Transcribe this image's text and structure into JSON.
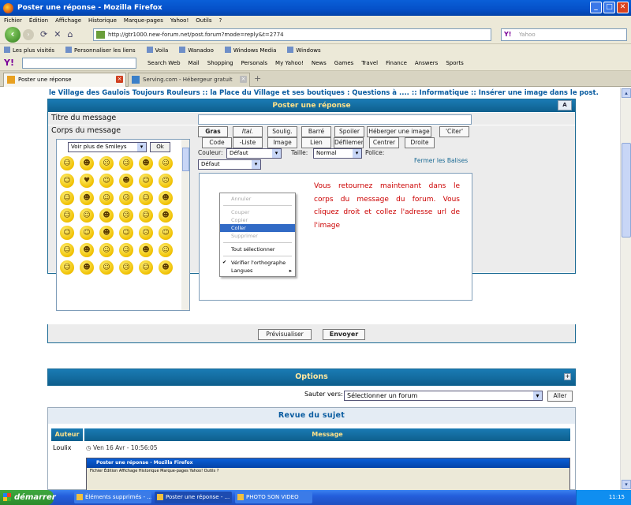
{
  "window": {
    "title": "Poster une réponse - Mozilla Firefox"
  },
  "menu": [
    "Fichier",
    "Édition",
    "Affichage",
    "Historique",
    "Marque-pages",
    "Yahoo!",
    "Outils",
    "?"
  ],
  "nav": {
    "url": "http://gtr1000.new-forum.net/post.forum?mode=reply&t=2774",
    "search_placeholder": "Yahoo"
  },
  "bookmarks": [
    "Les plus visités",
    "Personnaliser les liens",
    "Voila",
    "Wanadoo",
    "Windows Media",
    "Windows"
  ],
  "yahoo_toolbar": [
    "Search Web",
    "Mail",
    "Shopping",
    "Personals",
    "My Yahoo!",
    "News",
    "Games",
    "Travel",
    "Finance",
    "Answers",
    "Sports"
  ],
  "tabs": [
    {
      "label": "Poster une réponse"
    },
    {
      "label": "Serving.com - Hébergeur gratuit d'ima..."
    }
  ],
  "breadcrumb": "le Village des Gaulois Toujours Rouleurs  :: la Place du Village et ses boutiques : Questions à .... :: Informatique :: Insérer une image dans le post.",
  "post": {
    "header": "Poster une réponse",
    "title_label": "Titre du message",
    "body_label": "Corps du message",
    "smiley_select": "Voir plus de Smileys",
    "ok": "Ok",
    "buttons_row1": [
      "Gras",
      "Ital.",
      "Soulig.",
      "Barré",
      "Spoiler",
      "Héberger une image",
      "'Citer'"
    ],
    "buttons_row2": [
      "Code",
      "-Liste",
      "Image",
      "Lien",
      "Défilement",
      "Centrer",
      "Droite"
    ],
    "color_label": "Couleur:",
    "color_value": "Défaut",
    "size_label": "Taille:",
    "size_value": "Normal",
    "font_label": "Police:",
    "font_value": "Défaut",
    "close_tags": "Fermer les Balises",
    "editor_text": "Vous retournez maintenant dans le corps du message du forum. Vous cliquez droit et collez l'adresse url de l'image",
    "preview": "Prévisualiser",
    "send": "Envoyer"
  },
  "context_menu": [
    "Annuler",
    "Couper",
    "Copier",
    "Coller",
    "Supprimer",
    "Tout sélectionner",
    "Vérifier l'orthographe",
    "Langues"
  ],
  "options": {
    "title": "Options",
    "jump_label": "Sauter vers:",
    "jump_value": "Sélectionner un forum",
    "go": "Aller"
  },
  "review": {
    "title": "Revue du sujet",
    "col_author": "Auteur",
    "col_message": "Message",
    "author": "Loulix",
    "date": "Ven 16 Avr - 10:56:05"
  },
  "mini_window": {
    "title": "Poster une réponse - Mozilla Firefox",
    "menu": "Fichier  Édition  Affichage  Historique  Marque-pages  Yahoo!  Outils  ?"
  },
  "taskbar": {
    "start": "démarrer",
    "tasks": [
      "Éléments supprimés - ...",
      "Poster une réponse - ...",
      "PHOTO SON VIDEO"
    ],
    "clock": "11:15"
  }
}
